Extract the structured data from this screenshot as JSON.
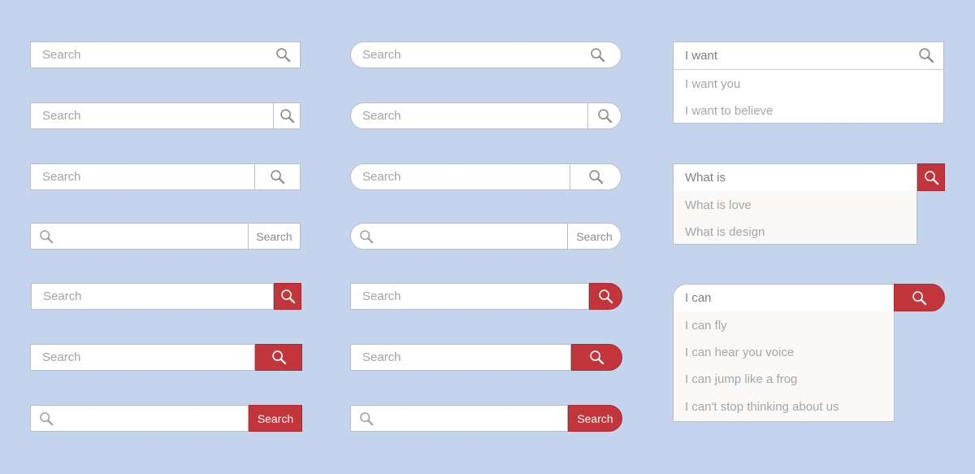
{
  "placeholder": "Search",
  "button_label": "Search",
  "colors": {
    "background": "#c3d4ec",
    "accent_red": "#c2353b",
    "border": "#b9bfc8",
    "placeholder_text": "#a3a3a3"
  },
  "icons": {
    "search": "magnifier-icon"
  },
  "dropdown_want": {
    "query": "I want",
    "suggestions": [
      "I want you",
      "I want to believe"
    ]
  },
  "dropdown_what": {
    "query": "What is",
    "suggestions": [
      "What is love",
      "What is design"
    ]
  },
  "dropdown_can": {
    "query": "I can",
    "suggestions": [
      "I can fly",
      "I can hear you voice",
      "I can jump like a frog",
      "I can't stop thinking about us"
    ]
  }
}
